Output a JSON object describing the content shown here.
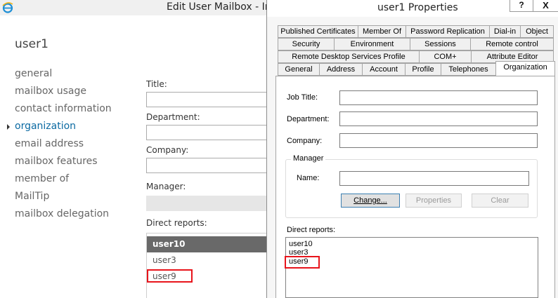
{
  "background_window": {
    "title": "Edit User Mailbox - In",
    "app_icon": "ie-icon",
    "user_heading": "user1",
    "nav": [
      {
        "label": "general",
        "active": false
      },
      {
        "label": "mailbox usage",
        "active": false
      },
      {
        "label": "contact information",
        "active": false
      },
      {
        "label": "organization",
        "active": true
      },
      {
        "label": "email address",
        "active": false
      },
      {
        "label": "mailbox features",
        "active": false
      },
      {
        "label": "member of",
        "active": false
      },
      {
        "label": "MailTip",
        "active": false
      },
      {
        "label": "mailbox delegation",
        "active": false
      }
    ],
    "fields": {
      "title_label": "Title:",
      "title_value": "",
      "department_label": "Department:",
      "department_value": "",
      "company_label": "Company:",
      "company_value": "",
      "manager_label": "Manager:",
      "manager_value": "",
      "direct_reports_label": "Direct reports:"
    },
    "direct_reports": [
      {
        "name": "user10",
        "selected": true
      },
      {
        "name": "user3",
        "selected": false
      },
      {
        "name": "user9",
        "selected": false,
        "highlighted": true
      }
    ]
  },
  "dialog": {
    "title": "user1 Properties",
    "help_button": "?",
    "close_button": "X",
    "tab_rows": [
      [
        "Published Certificates",
        "Member Of",
        "Password Replication",
        "Dial-in",
        "Object"
      ],
      [
        "Security",
        "Environment",
        "Sessions",
        "Remote control"
      ],
      [
        "Remote Desktop Services Profile",
        "COM+",
        "Attribute Editor"
      ],
      [
        "General",
        "Address",
        "Account",
        "Profile",
        "Telephones",
        "Organization"
      ]
    ],
    "active_tab": "Organization",
    "fields": {
      "job_title_label": "Job Title:",
      "job_title_value": "",
      "department_label": "Department:",
      "department_value": "",
      "company_label": "Company:",
      "company_value": "",
      "manager_group_label": "Manager",
      "name_label": "Name:",
      "name_value": "",
      "change_button": "Change...",
      "properties_button": "Properties",
      "clear_button": "Clear",
      "direct_reports_label": "Direct reports:"
    },
    "direct_reports": [
      "user10",
      "user3",
      "user9"
    ],
    "highlighted_report": "user9"
  },
  "colors": {
    "highlight_box": "#e8141b",
    "active_nav": "#0b6aa2",
    "selected_row": "#696969"
  }
}
